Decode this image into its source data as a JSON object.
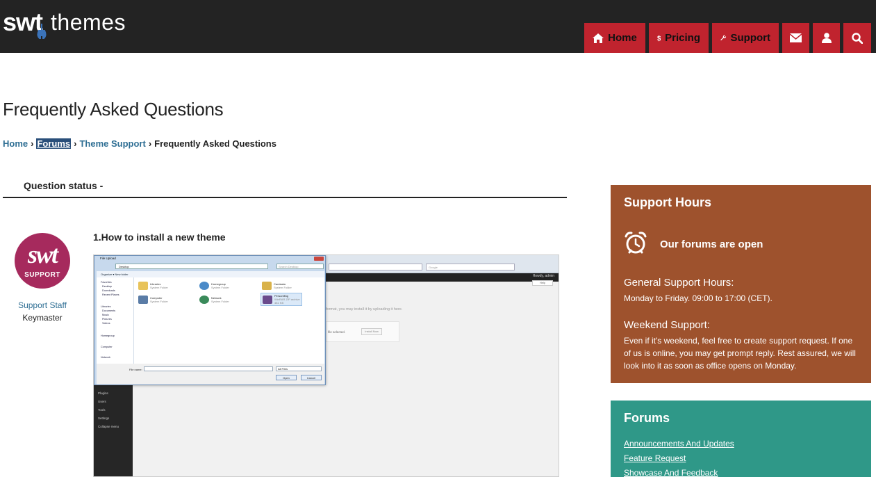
{
  "header": {
    "logo_swt": "swt",
    "logo_themes": "themes",
    "nav": {
      "home": "Home",
      "pricing": "Pricing",
      "support": "Support"
    }
  },
  "page": {
    "title": "Frequently Asked Questions",
    "breadcrumb": {
      "home": "Home",
      "forums": "Forums",
      "theme_support": "Theme Support",
      "current": "Frequently Asked Questions",
      "separator": "›"
    },
    "question_status": "Question status -",
    "author": {
      "avatar_logo": "swt",
      "avatar_label": "SUPPORT",
      "role": "Support Staff",
      "name": "Keymaster"
    },
    "question_title": "1.How to install a new theme",
    "screenshot": {
      "dialog_title": "File Upload",
      "address": "Desktop",
      "search_placeholder": "Search Desktop",
      "browser_search": "Google",
      "admin_greeting": "Howdy, admin",
      "help": "Help",
      "toolbar": "Organize ▾     New folder",
      "left_items": [
        "Favorites",
        "Desktop",
        "Downloads",
        "Recent Places",
        "Libraries",
        "Documents",
        "Music",
        "Pictures",
        "Videos",
        "Homegroup",
        "Computer",
        "Network"
      ],
      "tiles": [
        {
          "name": "Libraries",
          "sub": "System Folder"
        },
        {
          "name": "Homegroup",
          "sub": "System Folder"
        },
        {
          "name": "Camtasia",
          "sub": "System Folder"
        },
        {
          "name": "Computer",
          "sub": "System Folder"
        },
        {
          "name": "Network",
          "sub": "System Folder"
        },
        {
          "name": "Personifing",
          "sub": "WinRAR ZIP archive"
        }
      ],
      "tile_size": "481 KB",
      "file_name_label": "File name:",
      "file_type": "All Files",
      "open": "Open",
      "cancel": "Cancel",
      "upload_text": "format, you may install it by uploading it here.",
      "no_file": "file selected.",
      "install_now": "Install Now",
      "wp_menu": [
        "Plugins",
        "Users",
        "Tools",
        "Settings",
        "Collapse menu"
      ]
    }
  },
  "sidebar": {
    "support_hours": {
      "title": "Support Hours",
      "open_text": "Our forums are open",
      "general_title": "General Support Hours:",
      "general_text": "Monday to Friday. 09:00 to 17:00 (CET).",
      "weekend_title": "Weekend Support:",
      "weekend_text": "Even if it's weekend, feel free to create support request. If one of us is online, you may get prompt reply. Rest assured, we will look into it as soon as office opens on Monday."
    },
    "forums": {
      "title": "Forums",
      "links": [
        "Announcements And Updates",
        "Feature Request",
        "Showcase And Feedback"
      ]
    }
  },
  "colors": {
    "header_bg": "#232323",
    "nav_red": "#c0232e",
    "link_blue": "#2f6f94",
    "hours_brown": "#9e522d",
    "forums_teal": "#2f9888",
    "avatar_magenta": "#a62a5d"
  }
}
